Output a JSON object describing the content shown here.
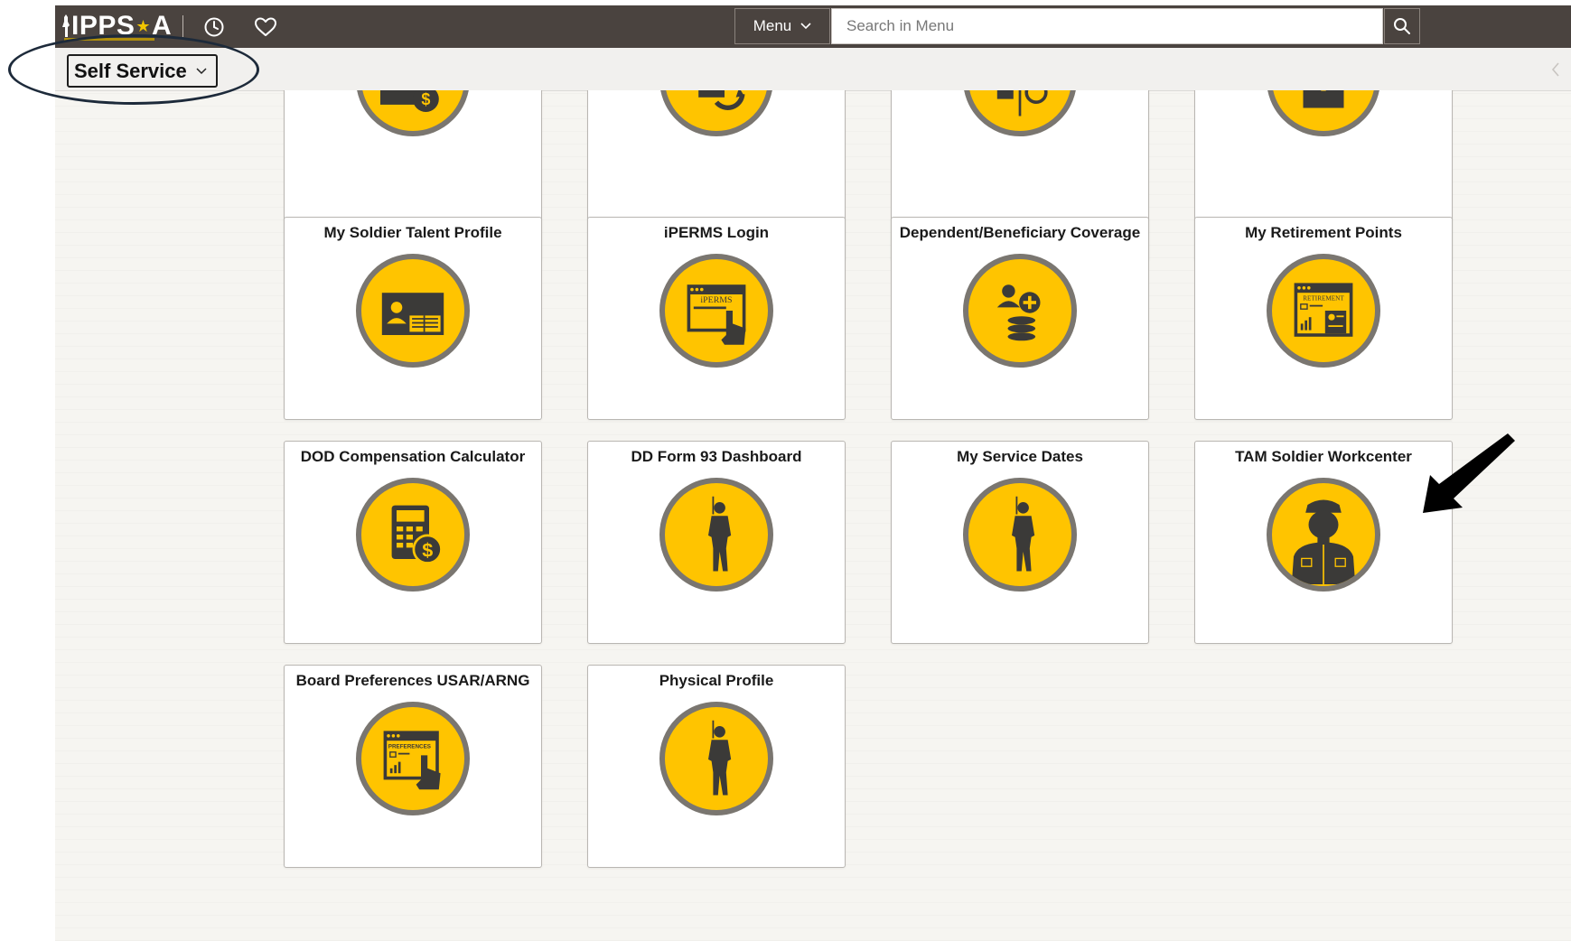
{
  "header": {
    "logo_text": "IPPS",
    "logo_star": "★",
    "logo_suffix": "A",
    "icons": [
      "history-icon",
      "favorites-icon"
    ],
    "menu_label": "Menu",
    "search_placeholder": "Search in Menu"
  },
  "subheader": {
    "homepage_label": "Self Service"
  },
  "colors": {
    "topbar": "#4a433f",
    "tile_icon_fill": "#ffc400",
    "tile_icon_ring": "#7a7670",
    "icon_dark": "#3b3a38",
    "annotation": "#1d2a3a"
  },
  "tiles": [
    {
      "title": "",
      "icon": "payment-icon"
    },
    {
      "title": "",
      "icon": "refresh-document-icon"
    },
    {
      "title": "",
      "icon": "split-document-icon"
    },
    {
      "title": "",
      "icon": "lock-icon"
    },
    {
      "title": "My Soldier Talent Profile",
      "icon": "id-card-icon"
    },
    {
      "title": "iPERMS Login",
      "icon": "iperms-window-icon",
      "icon_text": "iPERMS"
    },
    {
      "title": "Dependent/Beneficiary Coverage",
      "icon": "dependent-coins-icon"
    },
    {
      "title": "My Retirement Points",
      "icon": "retirement-report-icon",
      "icon_text": "RETIREMENT"
    },
    {
      "title": "DOD Compensation Calculator",
      "icon": "calculator-dollar-icon"
    },
    {
      "title": "DD Form 93 Dashboard",
      "icon": "soldier-silhouette-icon"
    },
    {
      "title": "My Service Dates",
      "icon": "soldier-silhouette-icon"
    },
    {
      "title": "TAM Soldier Workcenter",
      "icon": "soldier-bust-icon"
    },
    {
      "title": "Board Preferences USAR/ARNG",
      "icon": "preferences-window-icon",
      "icon_text": "PREFERENCES"
    },
    {
      "title": "Physical Profile",
      "icon": "soldier-silhouette-icon"
    }
  ]
}
